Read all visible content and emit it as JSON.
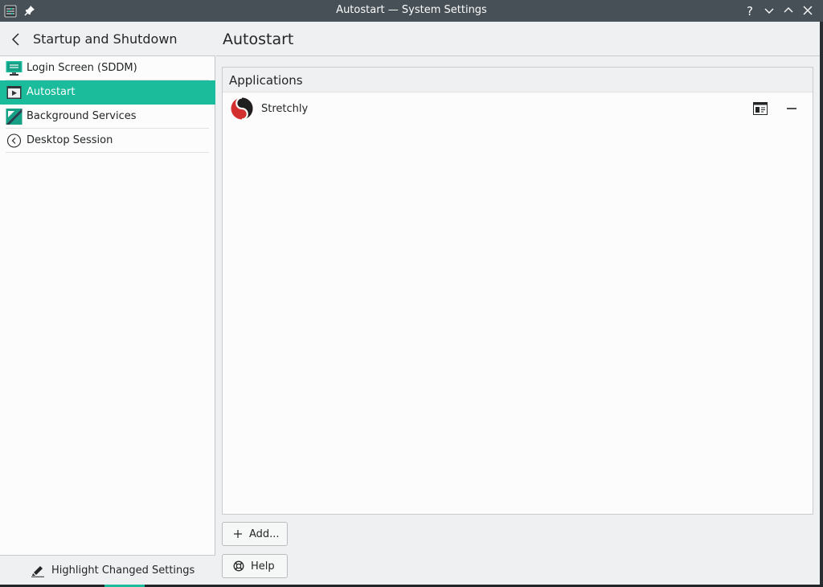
{
  "window": {
    "title": "Autostart — System Settings"
  },
  "sidebar": {
    "title": "Startup and Shutdown",
    "items": [
      {
        "label": "Login Screen (SDDM)",
        "icon": "monitor-icon",
        "active": false
      },
      {
        "label": "Autostart",
        "icon": "autostart-icon",
        "active": true
      },
      {
        "label": "Background Services",
        "icon": "background-services-icon",
        "active": false
      },
      {
        "label": "Desktop Session",
        "icon": "session-icon",
        "active": false
      }
    ],
    "footer_label": "Highlight Changed Settings"
  },
  "main": {
    "title": "Autostart",
    "section_label": "Applications",
    "applications": [
      {
        "name": "Stretchly",
        "icon": "stretchly-logo"
      }
    ],
    "add_label": "Add...",
    "help_label": "Help"
  },
  "colors": {
    "accent": "#1abc9c",
    "titlebar": "#475057",
    "background": "#eff0f1",
    "panel": "#fcfcfc"
  }
}
